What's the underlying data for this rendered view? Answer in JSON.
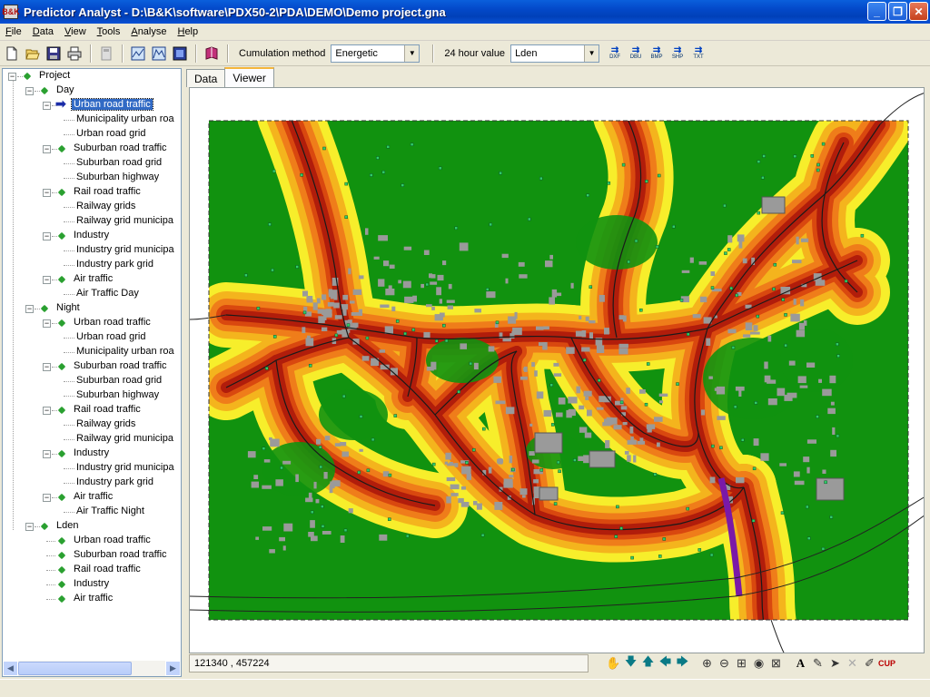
{
  "window": {
    "title": "Predictor Analyst - D:\\B&K\\software\\PDX50-2\\PDA\\DEMO\\Demo project.gna",
    "icon_text": "B&K",
    "minimize": "_",
    "maximize": "❐",
    "close": "✕"
  },
  "menu": [
    "File",
    "Data",
    "View",
    "Tools",
    "Analyse",
    "Help"
  ],
  "toolbar": {
    "cumulation_label": "Cumulation method",
    "cumulation_value": "Energetic",
    "hour_label": "24 hour value",
    "hour_value": "Lden",
    "exports": [
      "DXF",
      "DBU",
      "BMP",
      "SHP",
      "TXT"
    ]
  },
  "tree": [
    {
      "label": "Project",
      "level": 0,
      "type": "group",
      "expanded": true
    },
    {
      "label": "Day",
      "level": 1,
      "type": "group",
      "expanded": true
    },
    {
      "label": "Urban road traffic",
      "level": 2,
      "type": "group",
      "expanded": true,
      "selected": true
    },
    {
      "label": "Municipality urban roa",
      "level": 3,
      "type": "leaf"
    },
    {
      "label": "Urban road grid",
      "level": 3,
      "type": "leaf"
    },
    {
      "label": "Suburban road traffic",
      "level": 2,
      "type": "group",
      "expanded": true
    },
    {
      "label": "Suburban road grid",
      "level": 3,
      "type": "leaf"
    },
    {
      "label": "Suburban highway",
      "level": 3,
      "type": "leaf"
    },
    {
      "label": "Rail road traffic",
      "level": 2,
      "type": "group",
      "expanded": true
    },
    {
      "label": "Railway grids",
      "level": 3,
      "type": "leaf"
    },
    {
      "label": "Railway grid municipa",
      "level": 3,
      "type": "leaf"
    },
    {
      "label": "Industry",
      "level": 2,
      "type": "group",
      "expanded": true
    },
    {
      "label": "Industry grid municipa",
      "level": 3,
      "type": "leaf"
    },
    {
      "label": "Industry park grid",
      "level": 3,
      "type": "leaf"
    },
    {
      "label": "Air traffic",
      "level": 2,
      "type": "group",
      "expanded": true
    },
    {
      "label": "Air Traffic Day",
      "level": 3,
      "type": "leaf"
    },
    {
      "label": "Night",
      "level": 1,
      "type": "group",
      "expanded": true
    },
    {
      "label": "Urban road traffic",
      "level": 2,
      "type": "group",
      "expanded": true
    },
    {
      "label": "Urban road grid",
      "level": 3,
      "type": "leaf"
    },
    {
      "label": "Municipality urban roa",
      "level": 3,
      "type": "leaf"
    },
    {
      "label": "Suburban road traffic",
      "level": 2,
      "type": "group",
      "expanded": true
    },
    {
      "label": "Suburban road grid",
      "level": 3,
      "type": "leaf"
    },
    {
      "label": "Suburban highway",
      "level": 3,
      "type": "leaf"
    },
    {
      "label": "Rail road traffic",
      "level": 2,
      "type": "group",
      "expanded": true
    },
    {
      "label": "Railway grids",
      "level": 3,
      "type": "leaf"
    },
    {
      "label": "Railway grid municipa",
      "level": 3,
      "type": "leaf"
    },
    {
      "label": "Industry",
      "level": 2,
      "type": "group",
      "expanded": true
    },
    {
      "label": "Industry grid municipa",
      "level": 3,
      "type": "leaf"
    },
    {
      "label": "Industry park grid",
      "level": 3,
      "type": "leaf"
    },
    {
      "label": "Air traffic",
      "level": 2,
      "type": "group",
      "expanded": true
    },
    {
      "label": "Air Traffic Night",
      "level": 3,
      "type": "leaf"
    },
    {
      "label": "Lden",
      "level": 1,
      "type": "group",
      "expanded": true
    },
    {
      "label": "Urban road traffic",
      "level": 2,
      "type": "item"
    },
    {
      "label": "Suburban road traffic",
      "level": 2,
      "type": "item"
    },
    {
      "label": "Rail road traffic",
      "level": 2,
      "type": "item"
    },
    {
      "label": "Industry",
      "level": 2,
      "type": "item"
    },
    {
      "label": "Air traffic",
      "level": 2,
      "type": "item"
    }
  ],
  "tabs": [
    {
      "label": "Data",
      "active": false
    },
    {
      "label": "Viewer",
      "active": true
    }
  ],
  "status": {
    "coordinates": "121340 , 457224"
  },
  "map_colors": {
    "background": "#ffffff",
    "quiet": "#11920f",
    "low": "#f7ee2b",
    "medium": "#f4b41d",
    "high": "#ef7d1a",
    "very_high": "#d9480f",
    "extreme": "#b11d0b",
    "peak": "#7a19a8",
    "building": "#9a9a9a",
    "road": "#1a1a1a",
    "receiver": "#2fcf6a"
  }
}
